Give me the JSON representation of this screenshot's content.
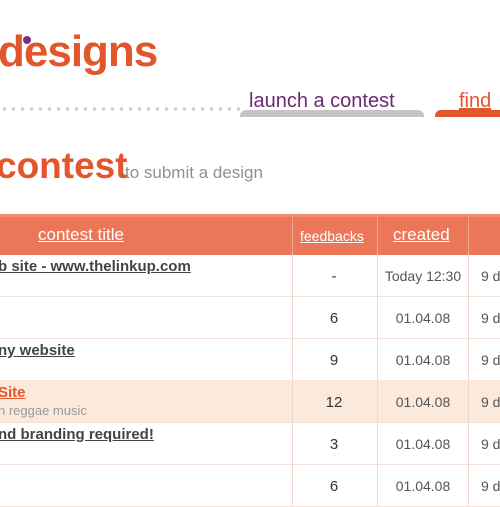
{
  "brand": {
    "logo_text": "designs",
    "accent": "#e2562c",
    "purple": "#6b2a72"
  },
  "nav": {
    "launch_label": "launch a contest",
    "find_label": "find"
  },
  "page": {
    "title": "contest",
    "subtitle": "to submit a design"
  },
  "table": {
    "headers": {
      "title": "contest title",
      "feedbacks": "feedbacks",
      "created": "created"
    },
    "rows": [
      {
        "title": "b site - www.thelinkup.com",
        "subtitle": "",
        "feedbacks": "-",
        "created": "Today 12:30",
        "ends": "9 d",
        "highlight": false
      },
      {
        "title": "",
        "subtitle": "",
        "feedbacks": "6",
        "created": "01.04.08",
        "ends": "9 d",
        "highlight": false
      },
      {
        "title": "ny website",
        "subtitle": "",
        "feedbacks": "9",
        "created": "01.04.08",
        "ends": "9 d",
        "highlight": false
      },
      {
        "title": "Site",
        "subtitle": "n reggae music",
        "feedbacks": "12",
        "created": "01.04.08",
        "ends": "9 d",
        "highlight": true
      },
      {
        "title": "nd branding required!",
        "subtitle": "",
        "feedbacks": "3",
        "created": "01.04.08",
        "ends": "9 d",
        "highlight": false
      },
      {
        "title": "",
        "subtitle": "",
        "feedbacks": "6",
        "created": "01.04.08",
        "ends": "9 d",
        "highlight": false
      }
    ]
  }
}
